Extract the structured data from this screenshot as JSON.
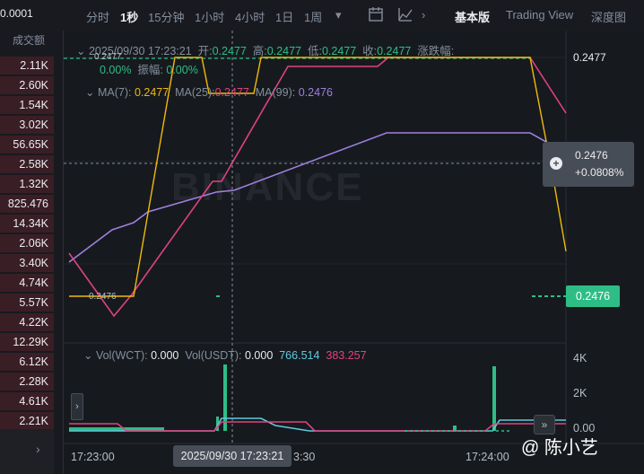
{
  "orderbook": {
    "top_value": "0.0001",
    "header": "成交额",
    "rows": [
      "2.11K",
      "2.60K",
      "1.54K",
      "3.02K",
      "56.65K",
      "2.58K",
      "1.32K",
      "825.476",
      "14.34K",
      "2.06K",
      "3.40K",
      "4.74K",
      "5.57K",
      "4.22K",
      "12.29K",
      "6.12K",
      "2.28K",
      "4.61K",
      "2.21K"
    ]
  },
  "toolbar": {
    "intervals": [
      "分时",
      "1秒",
      "15分钟",
      "1小时",
      "4小时",
      "1日",
      "1周"
    ],
    "active_interval": "1秒",
    "more_icon": "chevron-down-icon",
    "views": [
      "基本版",
      "Trading View",
      "深度图"
    ],
    "active_view": "基本版"
  },
  "legend": {
    "datetime": "2025/09/30 17:23:21",
    "open_label": "开:",
    "open": "0.2477",
    "high_label": "高:",
    "high": "0.2477",
    "low_label": "低:",
    "low": "0.2477",
    "close_label": "收:",
    "close": "0.2477",
    "change_label": "涨跌幅:",
    "change": "0.00%",
    "amp_label": "振幅:",
    "amp": "0.00%",
    "ma7_label": "MA(7):",
    "ma7": "0.2477",
    "ma25_label": "MA(25):",
    "ma25": "0.2477",
    "ma99_label": "MA(99):",
    "ma99": "0.2476",
    "mini_high": "0.2477",
    "mini_low": "0.2476"
  },
  "price_axis": {
    "top_price": "0.2477",
    "cross_price": "0.2476",
    "cross_change": "+0.0808%",
    "last_price": "0.2476"
  },
  "volume": {
    "vol_label": "Vol(WCT):",
    "vol_value": "0.000",
    "volu_label": "Vol(USDT):",
    "volu_value": "0.000",
    "ma1": "766.514",
    "ma2": "383.257",
    "axis": [
      "4K",
      "2K",
      "0.00"
    ]
  },
  "xaxis": {
    "labels": [
      "17:23:00",
      "3:30",
      "17:24:00"
    ],
    "tooltip": "2025/09/30 17:23:21"
  },
  "watermark": "BINANCE",
  "badge": "@ 陈小艺",
  "colors": {
    "up": "#2ebd85",
    "ma7": "#f0b90b",
    "ma25": "#e0427f",
    "ma99": "#9f7fe0",
    "bg": "#161a1e"
  }
}
